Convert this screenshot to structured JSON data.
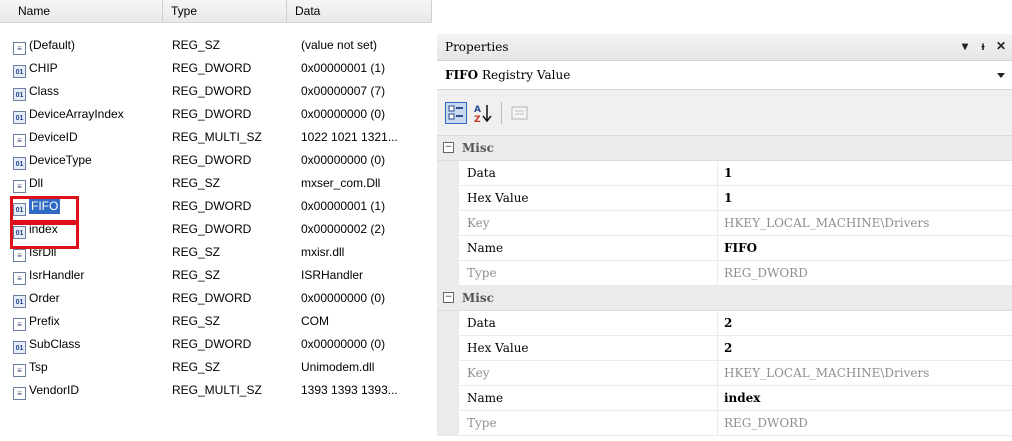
{
  "registry": {
    "columns": [
      "Name",
      "Type",
      "Data"
    ],
    "rows": [
      {
        "name": "(Default)",
        "type": "REG_SZ",
        "data": "(value not set)",
        "icon": "string-value-icon"
      },
      {
        "name": "CHIP",
        "type": "REG_DWORD",
        "data": "0x00000001 (1)",
        "icon": "binary-value-icon"
      },
      {
        "name": "Class",
        "type": "REG_DWORD",
        "data": "0x00000007 (7)",
        "icon": "binary-value-icon"
      },
      {
        "name": "DeviceArrayIndex",
        "type": "REG_DWORD",
        "data": "0x00000000 (0)",
        "icon": "binary-value-icon"
      },
      {
        "name": "DeviceID",
        "type": "REG_MULTI_SZ",
        "data": "1022 1021 1321...",
        "icon": "string-value-icon"
      },
      {
        "name": "DeviceType",
        "type": "REG_DWORD",
        "data": "0x00000000 (0)",
        "icon": "binary-value-icon"
      },
      {
        "name": "Dll",
        "type": "REG_SZ",
        "data": "mxser_com.Dll",
        "icon": "string-value-icon"
      },
      {
        "name": "FIFO",
        "type": "REG_DWORD",
        "data": "0x00000001 (1)",
        "icon": "binary-value-icon",
        "selected": true
      },
      {
        "name": "index",
        "type": "REG_DWORD",
        "data": "0x00000002 (2)",
        "icon": "binary-value-icon"
      },
      {
        "name": "IsrDll",
        "type": "REG_SZ",
        "data": "mxisr.dll",
        "icon": "string-value-icon"
      },
      {
        "name": "IsrHandler",
        "type": "REG_SZ",
        "data": "ISRHandler",
        "icon": "string-value-icon"
      },
      {
        "name": "Order",
        "type": "REG_DWORD",
        "data": "0x00000000 (0)",
        "icon": "binary-value-icon"
      },
      {
        "name": "Prefix",
        "type": "REG_SZ",
        "data": "COM",
        "icon": "string-value-icon"
      },
      {
        "name": "SubClass",
        "type": "REG_DWORD",
        "data": "0x00000000 (0)",
        "icon": "binary-value-icon"
      },
      {
        "name": "Tsp",
        "type": "REG_SZ",
        "data": "Unimodem.dll",
        "icon": "string-value-icon"
      },
      {
        "name": "VendorID",
        "type": "REG_MULTI_SZ",
        "data": "1393 1393 1393...",
        "icon": "string-value-icon"
      }
    ]
  },
  "properties": {
    "title": "Properties",
    "controls": {
      "dropdown": "▾",
      "pin": "ᵻ",
      "close": "✕"
    },
    "object_name": "FIFO",
    "object_kind": "Registry Value",
    "sections": [
      {
        "label": "Misc",
        "items": [
          {
            "key": "Data",
            "value": "1",
            "readonly": false,
            "bold": true
          },
          {
            "key": "Hex Value",
            "value": "1",
            "readonly": false,
            "bold": true
          },
          {
            "key": "Key",
            "value": "HKEY_LOCAL_MACHINE\\Drivers",
            "readonly": true,
            "bold": false
          },
          {
            "key": "Name",
            "value": "FIFO",
            "readonly": false,
            "bold": true
          },
          {
            "key": "Type",
            "value": "REG_DWORD",
            "readonly": true,
            "bold": false
          }
        ]
      },
      {
        "label": "Misc",
        "items": [
          {
            "key": "Data",
            "value": "2",
            "readonly": false,
            "bold": true
          },
          {
            "key": "Hex Value",
            "value": "2",
            "readonly": false,
            "bold": true
          },
          {
            "key": "Key",
            "value": "HKEY_LOCAL_MACHINE\\Drivers",
            "readonly": true,
            "bold": false
          },
          {
            "key": "Name",
            "value": "index",
            "readonly": false,
            "bold": true
          },
          {
            "key": "Type",
            "value": "REG_DWORD",
            "readonly": true,
            "bold": false
          }
        ]
      }
    ]
  },
  "colors": {
    "highlight": "#e0101a",
    "selection": "#316ac5"
  }
}
